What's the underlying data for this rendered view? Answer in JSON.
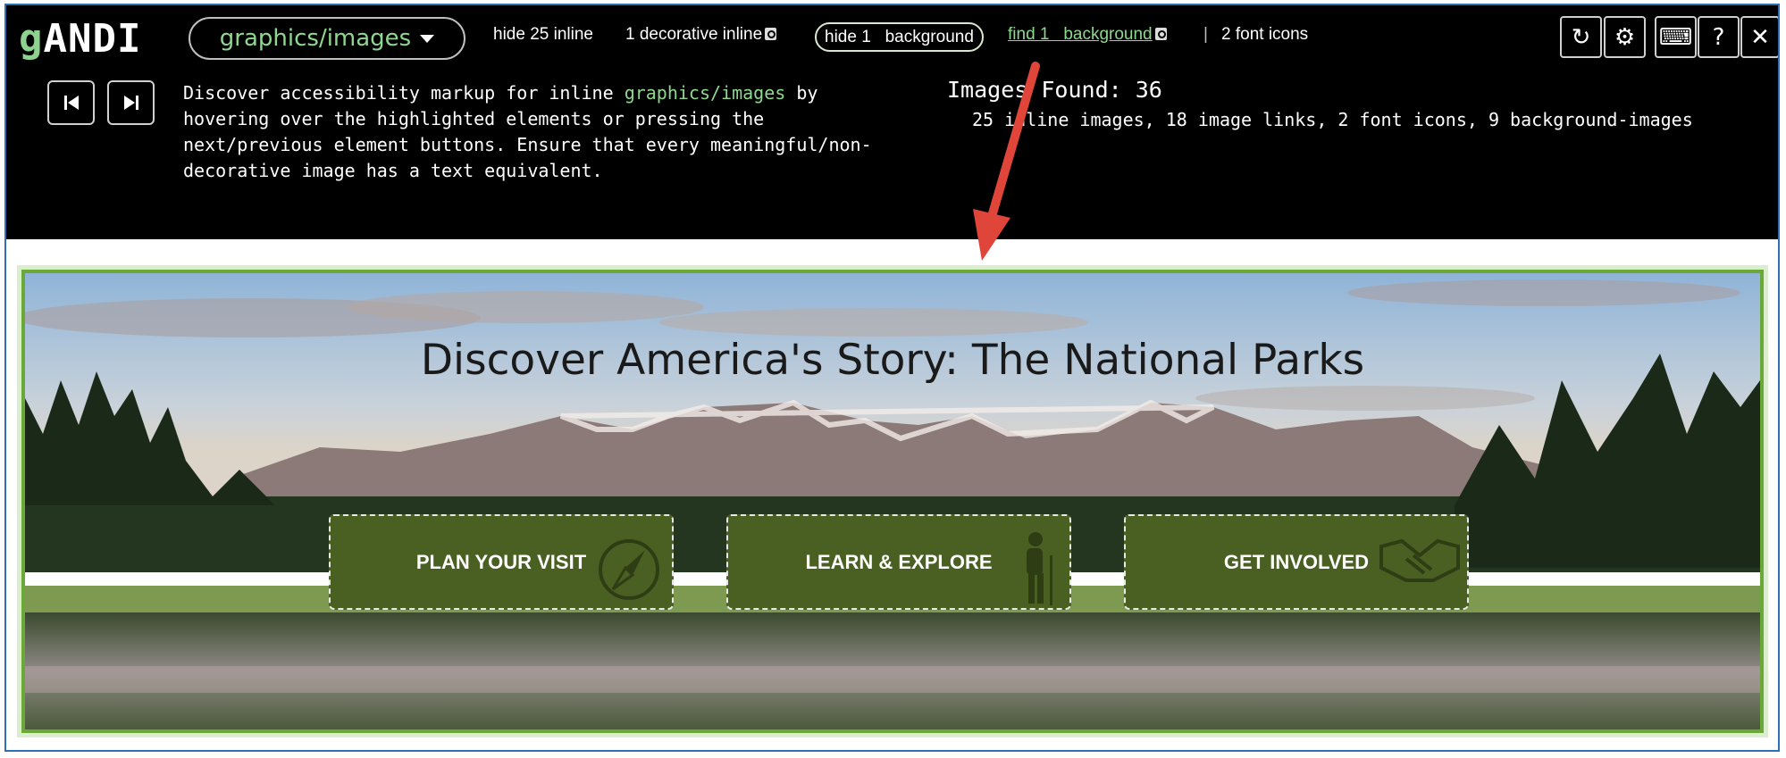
{
  "toolbar": {
    "logo_g": "g",
    "logo_andi": "ANDI",
    "module": "graphics/images",
    "hide_inline": "hide 25 inline",
    "decorative_inline": "1 decorative inline",
    "hide_background": "hide 1   background",
    "find_background": "find 1   background",
    "separator": "|",
    "font_icons": "2 font icons",
    "controls": [
      {
        "icon": "refresh-icon",
        "glyph": "↻"
      },
      {
        "icon": "gear-icon",
        "glyph": "⚙"
      },
      {
        "icon": "keyboard-icon",
        "glyph": "⌨"
      },
      {
        "icon": "help-icon",
        "glyph": "?"
      },
      {
        "icon": "close-icon",
        "glyph": "✕"
      }
    ]
  },
  "description": {
    "before": "Discover accessibility markup for inline ",
    "highlight": "graphics/images",
    "after": " by hovering over the highlighted elements or pressing the next/previous element buttons. Ensure that every meaningful/non-decorative image has a text equivalent."
  },
  "results": {
    "title": "Images Found: 36",
    "detail": "25 inline images, 18 image links, 2 font icons, 9 background-images"
  },
  "hero": {
    "title": "Discover America's Story: The National Parks",
    "buttons": [
      {
        "label": "PLAN YOUR VISIT",
        "icon": "compass-icon"
      },
      {
        "label": "LEARN & EXPLORE",
        "icon": "hiker-icon"
      },
      {
        "label": "GET INVOLVED",
        "icon": "handshake-icon"
      }
    ]
  },
  "colors": {
    "andi_green": "#8ed88e",
    "highlight_border": "#6aa838",
    "button_bg": "#4a5f22",
    "arrow": "#e0453a"
  }
}
